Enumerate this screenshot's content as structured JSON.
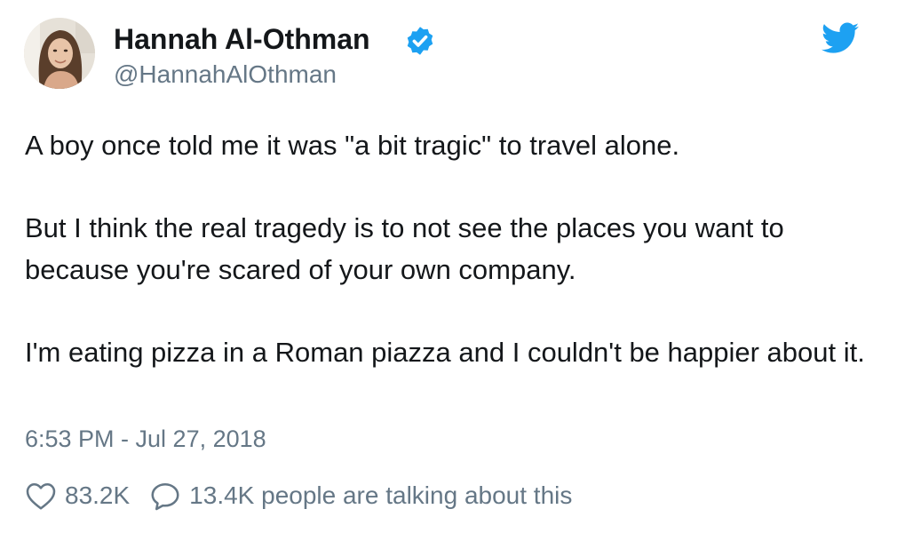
{
  "tweet": {
    "author": {
      "display_name": "Hannah Al-Othman",
      "handle": "@HannahAlOthman",
      "verified": true,
      "avatar_icon": "profile-photo"
    },
    "text_paragraphs": [
      "A boy once told me it was \"a bit tragic\" to travel alone.",
      "But I think the real tragedy is to not see the places you want to because you're scared of your own company.",
      "I'm eating pizza in a Roman piazza and I couldn't be happier about it."
    ],
    "timestamp": "6:53 PM - Jul 27, 2018",
    "likes": "83.2K",
    "conversation": "13.4K people are talking about this",
    "icons": {
      "brand": "twitter-bird-icon",
      "verified": "verified-badge-icon",
      "like": "heart-icon",
      "reply": "speech-bubble-icon"
    },
    "colors": {
      "brand_blue": "#1da1f2",
      "text": "#14171a",
      "secondary_text": "#657786"
    }
  }
}
